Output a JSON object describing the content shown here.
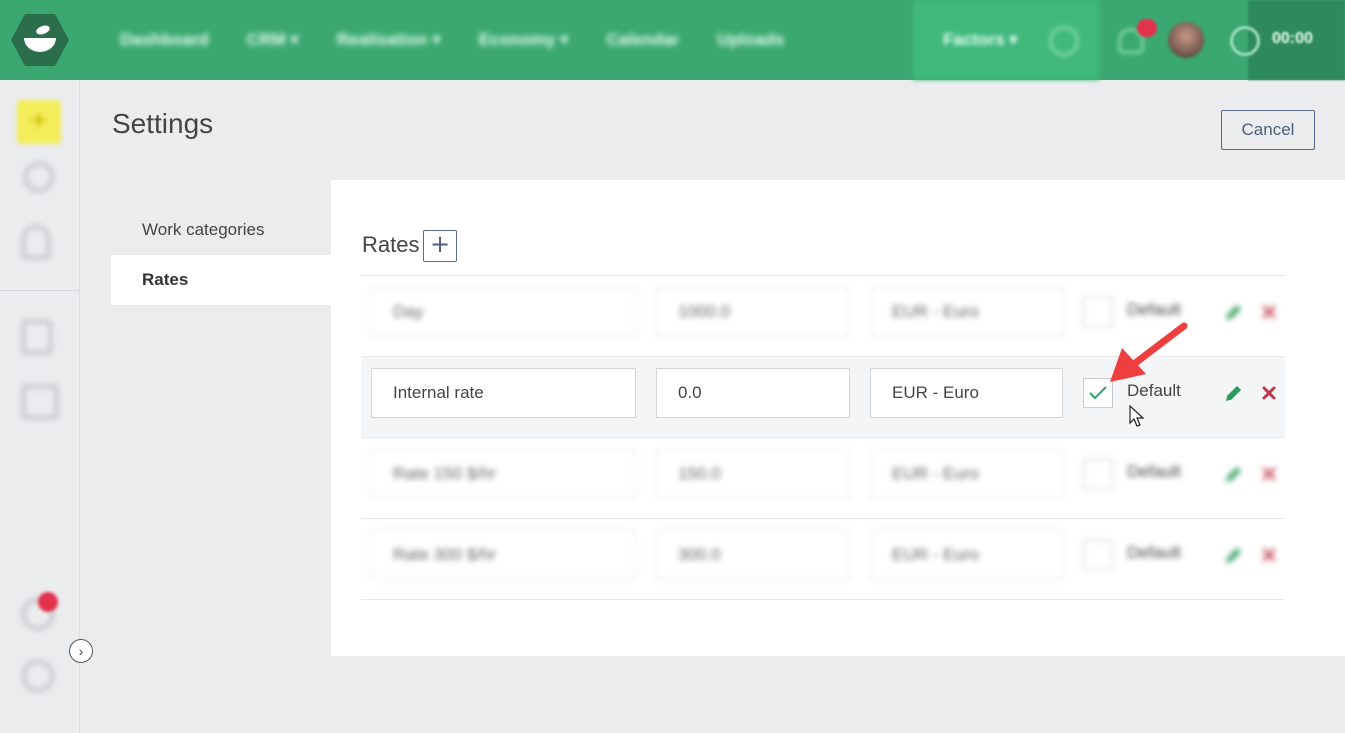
{
  "nav": {
    "items": [
      "Dashboard",
      "CRM ▾",
      "Realisation ▾",
      "Economy ▾",
      "Calendar",
      "Uploads"
    ],
    "factors_label": "Factors ▾",
    "timer": "00:00"
  },
  "page": {
    "title": "Settings",
    "cancel_label": "Cancel"
  },
  "subnav": {
    "items": [
      {
        "label": "Work categories",
        "active": false
      },
      {
        "label": "Rates",
        "active": true
      }
    ]
  },
  "rates": {
    "title": "Rates",
    "add_symbol": "+",
    "default_label": "Default",
    "rows": [
      {
        "name": "Day",
        "rate": "1000.0",
        "currency": "EUR - Euro",
        "default": false
      },
      {
        "name": "Internal rate",
        "rate": "0.0",
        "currency": "EUR - Euro",
        "default": true
      },
      {
        "name": "Rate 150 $/hr",
        "rate": "150.0",
        "currency": "EUR - Euro",
        "default": false
      },
      {
        "name": "Rate 300 $/hr",
        "rate": "300.0",
        "currency": "EUR - Euro",
        "default": false
      }
    ]
  },
  "colors": {
    "brand_green": "#3aa870",
    "edit_green": "#2e9a5c",
    "delete_red": "#c0394b",
    "annotation_arrow": "#ef3e3e"
  }
}
